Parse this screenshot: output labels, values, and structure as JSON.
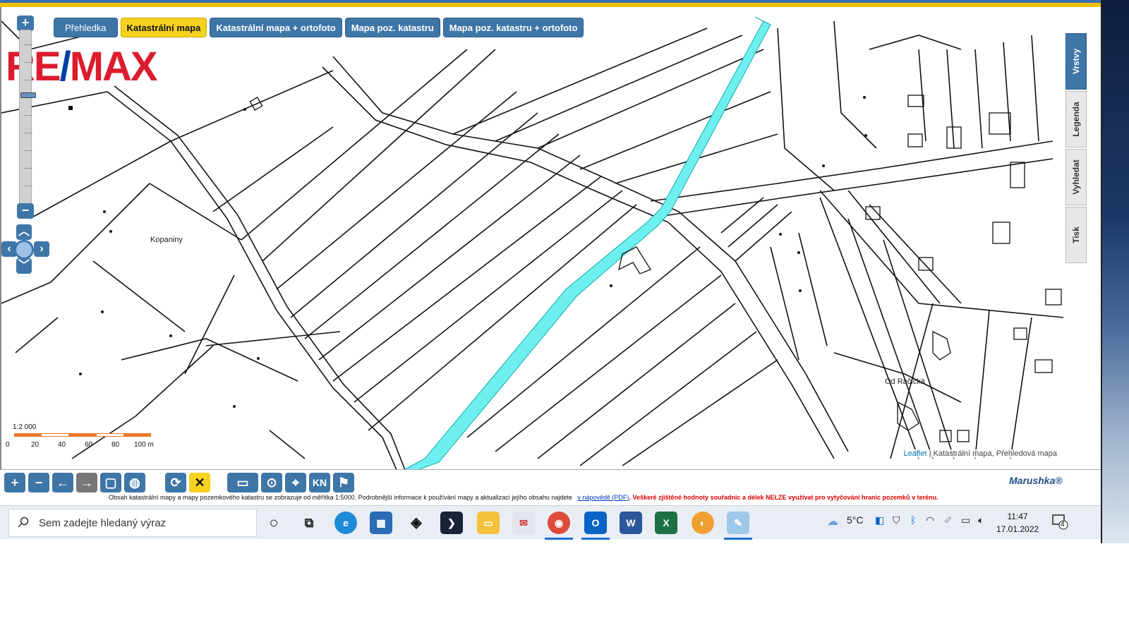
{
  "tabs": {
    "overview": "Přehledka",
    "cadastral_map": "Katastrální mapa",
    "cadastral_ortho": "Katastrální mapa + ortofoto",
    "land_map": "Mapa poz. katastru",
    "land_ortho": "Mapa poz. katastru + ortofoto"
  },
  "logo": {
    "part1": "RE",
    "part2": "/",
    "part3": "MAX",
    "red": "#dc1c2e",
    "blue": "#003da5"
  },
  "zoom": {
    "in": "+",
    "out": "−",
    "level_fraction": 0.35
  },
  "map": {
    "label_kopaniny": "Kopaniny",
    "label_racicka": "Od Račická",
    "attribution_link": "Leaflet",
    "attribution_sep": " | ",
    "attribution_text": "Katastrální mapa, Přehledová mapa",
    "highlight_color": "#6ff0f0"
  },
  "scale": {
    "ratio": "1:2 000",
    "labels": [
      "0",
      "20",
      "40",
      "60",
      "80",
      "100 m"
    ],
    "colors": [
      "#e8782a",
      "#ffffff"
    ]
  },
  "side_tabs": [
    "Vrstvy",
    "Legenda",
    "Vyhledat",
    "Tisk"
  ],
  "toolbar": {
    "zoom_in": "+",
    "zoom_out": "−",
    "back": "←",
    "forward": "→",
    "extent": "▢",
    "globe": "◍",
    "refresh": "⟳",
    "clear": "✕",
    "measure": "▭",
    "gps": "⊙",
    "locate": "⌖",
    "kn": "KN",
    "info": "⚑",
    "brand": "Marushka®"
  },
  "notice": {
    "text": "Obsah katastrální mapy a mapy pozemkového katastru se zobrazuje od měřítka 1:5000. Podrobnější informace k používání mapy a aktualizaci jejího obsahu najdete",
    "link": "v nápovědě (PDF)",
    "warning": ". Veškeré zjištěné hodnoty souřadnic a délek NELZE využívat pro vytyčování hranic pozemků v terénu."
  },
  "taskbar": {
    "search_placeholder": "Sem zadejte hledaný výraz",
    "weather": "5°C",
    "time": "11:47",
    "date": "17.01.2022",
    "notifications": "4"
  }
}
